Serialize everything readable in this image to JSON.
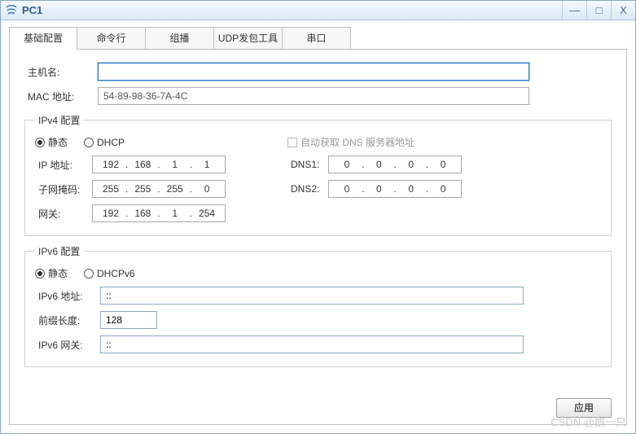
{
  "window": {
    "title": "PC1",
    "buttons": {
      "min": "—",
      "max": "□",
      "close": "X"
    }
  },
  "tabs": [
    "基础配置",
    "命令行",
    "组播",
    "UDP发包工具",
    "串口"
  ],
  "basic": {
    "hostname_label": "主机名:",
    "hostname_value": "",
    "mac_label": "MAC 地址:",
    "mac_value": "54-89-98-36-7A-4C"
  },
  "ipv4": {
    "legend": "IPv4 配置",
    "radio_static": "静态",
    "radio_dhcp": "DHCP",
    "auto_dns": "自动获取 DNS 服务器地址",
    "ip_label": "IP 地址:",
    "ip": [
      "192",
      "168",
      "1",
      "1"
    ],
    "mask_label": "子网掩码:",
    "mask": [
      "255",
      "255",
      "255",
      "0"
    ],
    "gw_label": "网关:",
    "gw": [
      "192",
      "168",
      "1",
      "254"
    ],
    "dns1_label": "DNS1:",
    "dns1": [
      "0",
      "0",
      "0",
      "0"
    ],
    "dns2_label": "DNS2:",
    "dns2": [
      "0",
      "0",
      "0",
      "0"
    ]
  },
  "ipv6": {
    "legend": "IPv6 配置",
    "radio_static": "静态",
    "radio_dhcp": "DHCPv6",
    "addr_label": "IPv6 地址:",
    "addr_value": "::",
    "prefix_label": "前缀长度:",
    "prefix_value": "128",
    "gw_label": "IPv6 网关:",
    "gw_value": "::"
  },
  "apply_label": "应用",
  "watermark": "CSDN @鹅一只"
}
